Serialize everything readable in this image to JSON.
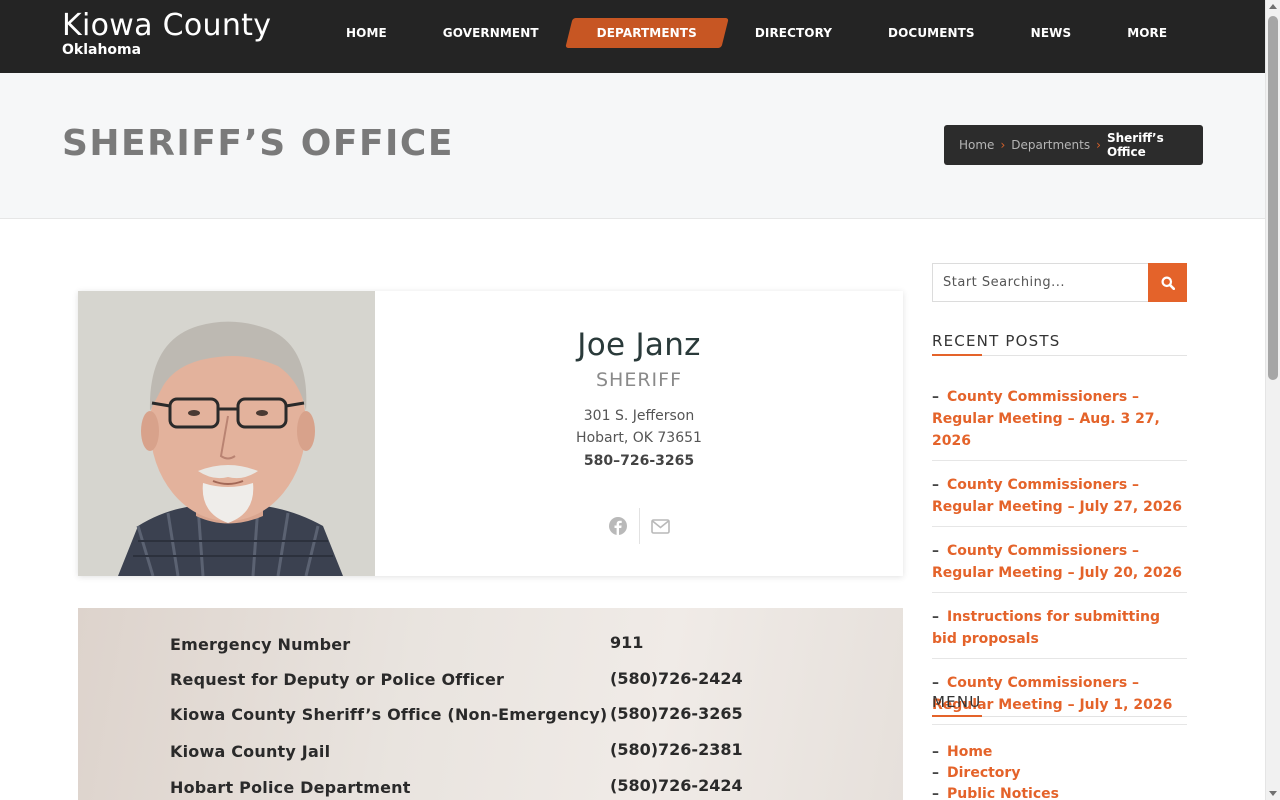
{
  "header": {
    "site_title": "Kiowa County",
    "site_subtitle": "Oklahoma",
    "nav": [
      {
        "label": "HOME"
      },
      {
        "label": "GOVERNMENT"
      },
      {
        "label": "DEPARTMENTS",
        "active": true
      },
      {
        "label": "DIRECTORY"
      },
      {
        "label": "DOCUMENTS"
      },
      {
        "label": "NEWS"
      },
      {
        "label": "MORE"
      }
    ],
    "accent_color": "#c75623"
  },
  "page": {
    "title": "SHERIFF’S OFFICE",
    "breadcrumb": [
      "Home",
      "Departments",
      "Sheriff’s Office"
    ]
  },
  "profile": {
    "name": "Joe Janz",
    "role": "SHERIFF",
    "address_line1": "301 S. Jefferson",
    "address_line2": "Hobart, OK 73651",
    "phone": "580–726-3265",
    "social_icons": [
      "facebook-icon",
      "envelope-icon"
    ]
  },
  "phone_list": [
    {
      "label": "Emergency Number",
      "number": "911"
    },
    {
      "label": "Request for Deputy or Police Officer",
      "number": "(580)726-2424"
    },
    {
      "label": "Kiowa County Sheriff’s Office (Non-Emergency)",
      "number": "(580)726-3265"
    },
    {
      "label": "Kiowa County Jail",
      "number": "(580)726-2381"
    },
    {
      "label": "Hobart Police Department",
      "number": "(580)726-2424"
    }
  ],
  "sidebar": {
    "search_placeholder": "Start Searching...",
    "recent_posts_title": "RECENT POSTS",
    "recent_posts": [
      "County Commissioners – Regular Meeting – Aug. 3 27, 2026",
      "County Commissioners – Regular Meeting – July 27, 2026",
      "County Commissioners – Regular Meeting – July 20, 2026",
      "Instructions for submitting bid proposals",
      "County Commissioners – Regular Meeting – July 1, 2026"
    ],
    "menu_title": "MENU",
    "menu_items": [
      "Home",
      "Directory",
      "Public Notices"
    ],
    "link_color": "#e4632a"
  }
}
